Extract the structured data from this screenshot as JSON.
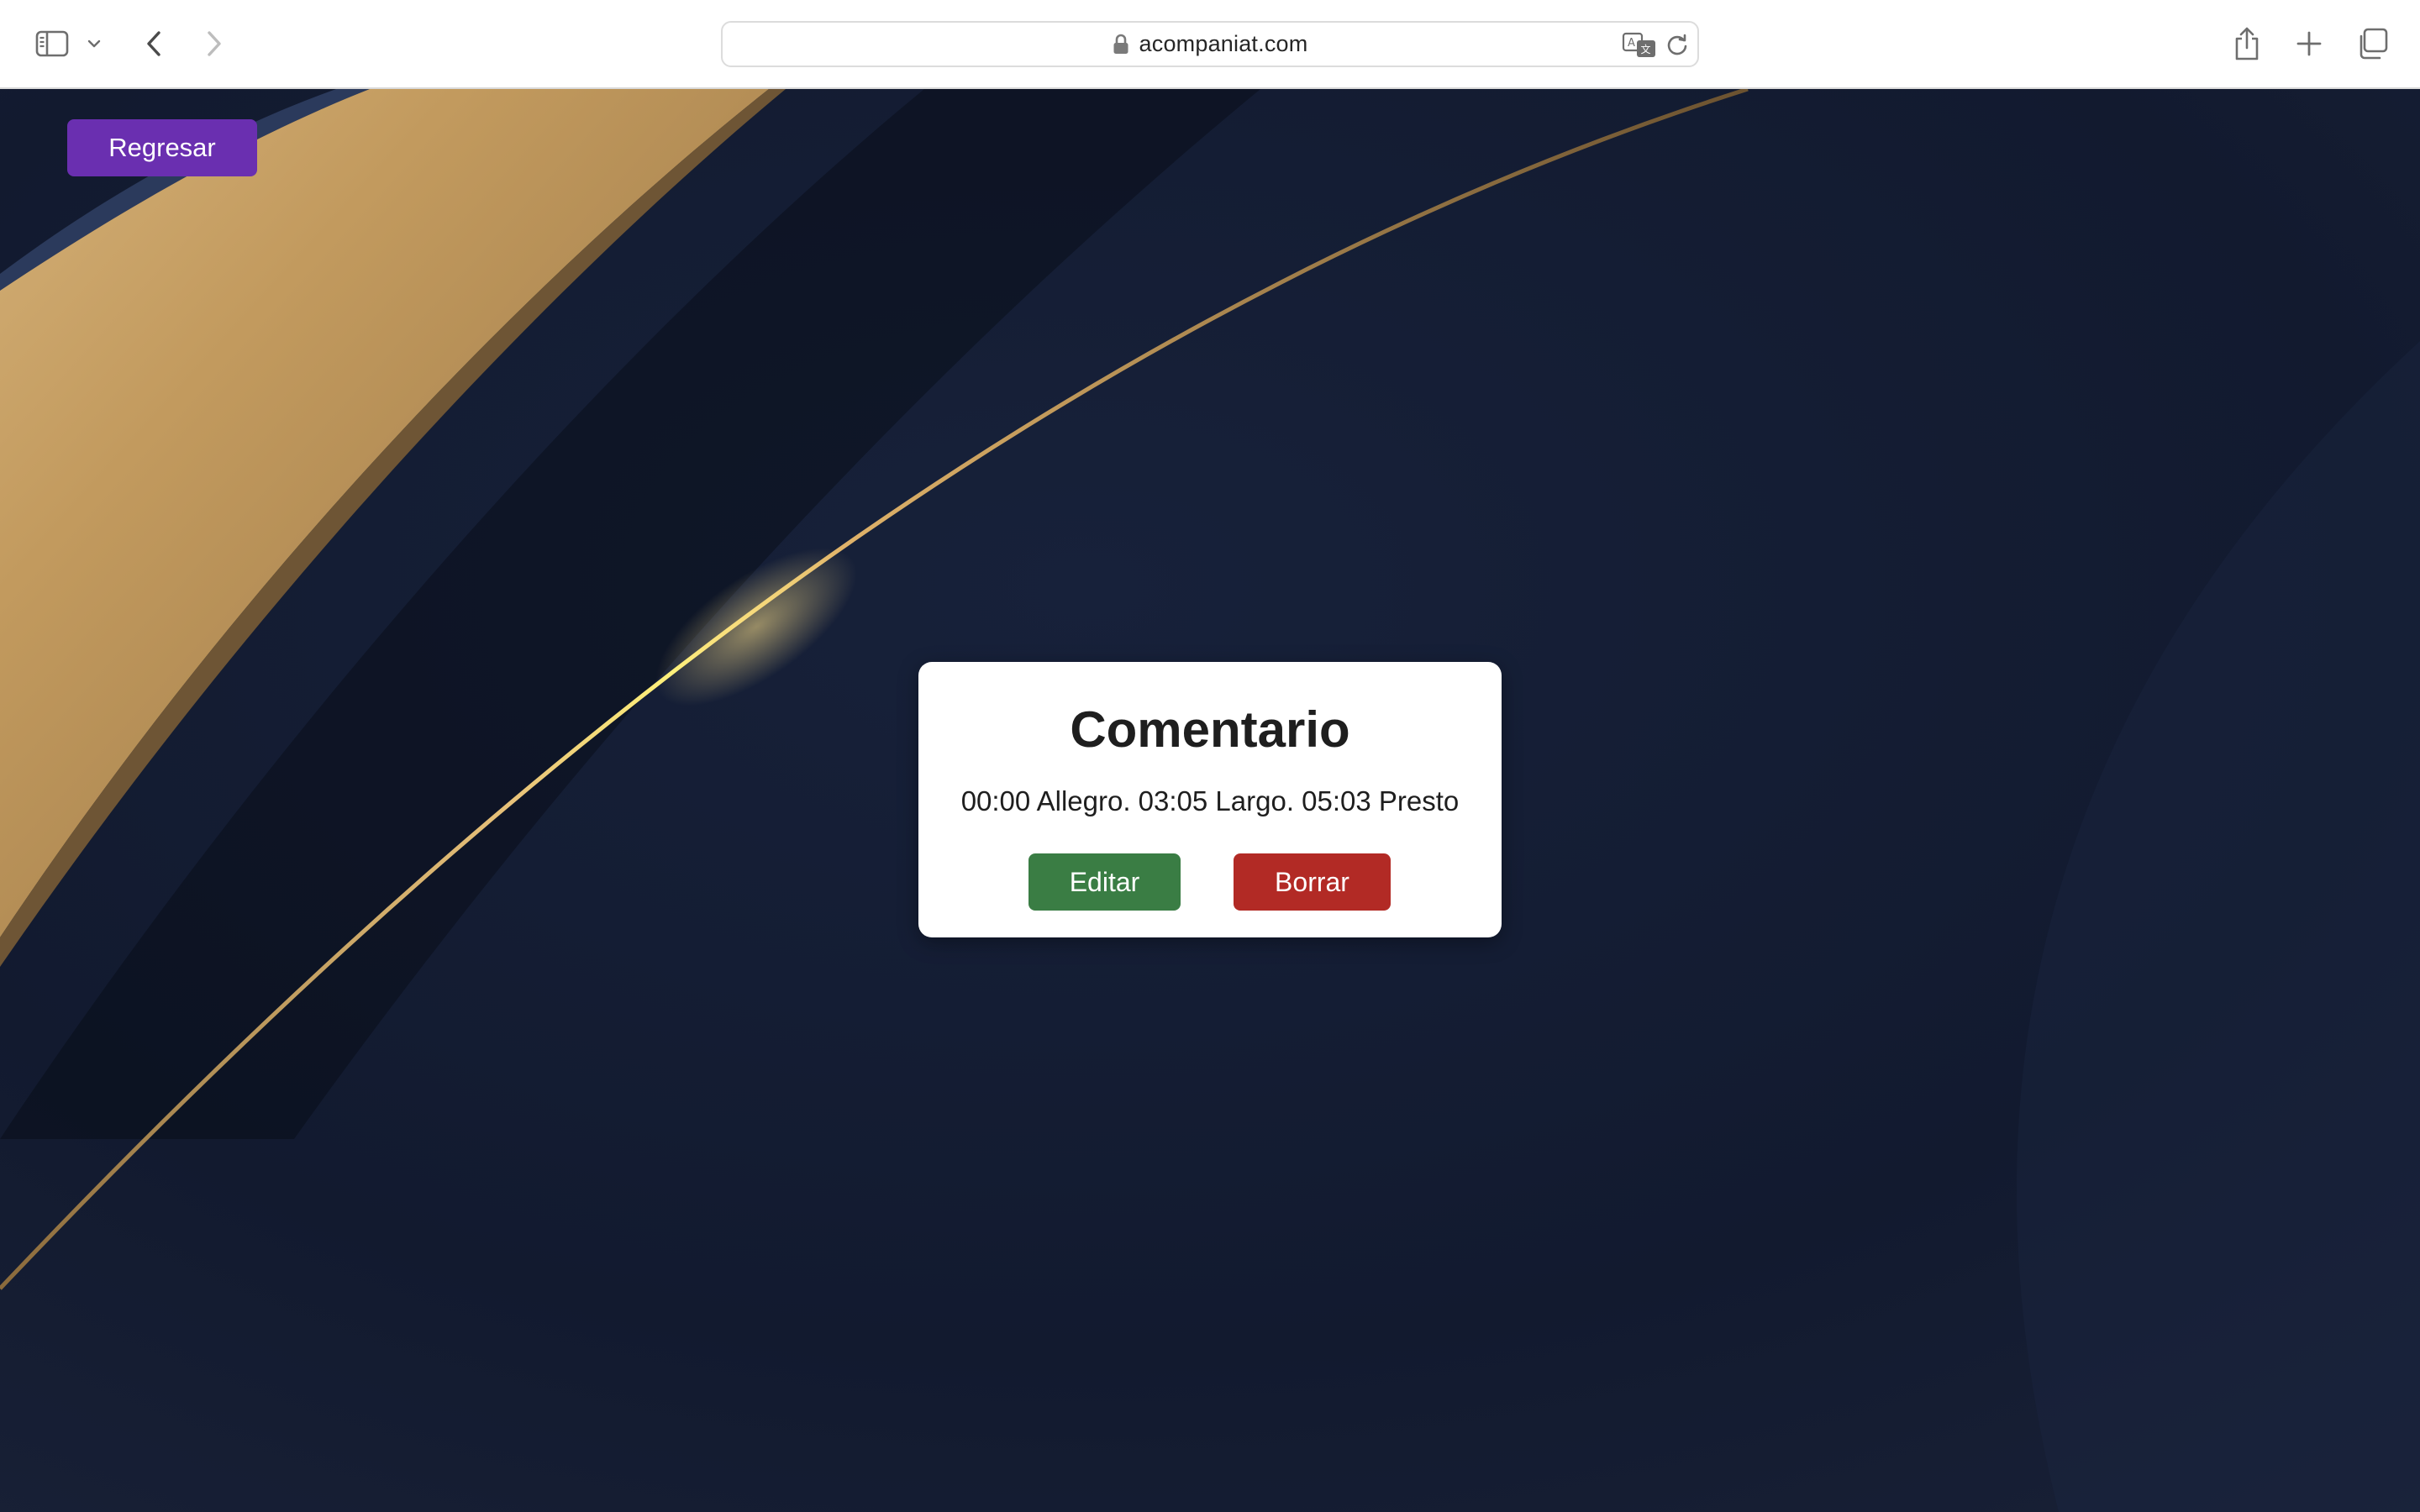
{
  "browser": {
    "url": "acompaniat.com",
    "icons": {
      "sidebar": "sidebar-icon",
      "sidebar_menu": "chevron-down-icon",
      "back": "chevron-left-icon",
      "forward": "chevron-right-icon",
      "lock": "lock-icon",
      "translate": "translate-icon",
      "reload": "reload-icon",
      "share": "share-icon",
      "new_tab": "plus-icon",
      "tab_overview": "tabs-icon"
    }
  },
  "page": {
    "back_button_label": "Regresar",
    "modal": {
      "title": "Comentario",
      "comment_text": "00:00 Allegro. 03:05 Largo. 05:03 Presto",
      "edit_label": "Editar",
      "delete_label": "Borrar"
    }
  },
  "colors": {
    "back_button": "#6a2fb0",
    "edit_button": "#3a7d44",
    "delete_button": "#b22a25",
    "background_navy": "#111a2e",
    "background_gold": "#c9a46a"
  }
}
